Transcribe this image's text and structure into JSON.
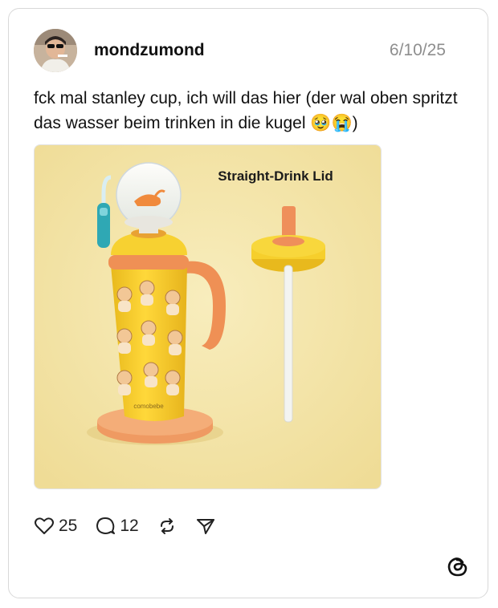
{
  "post": {
    "username": "mondzumond",
    "date": "6/10/25",
    "text": "fck mal stanley cup, ich will das hier (der wal oben spritzt das wasser beim trinken in die kugel 🥹😭)",
    "image": {
      "caption": "Straight-Drink Lid",
      "brand": "comobebe"
    }
  },
  "actions": {
    "likes": "25",
    "replies": "12"
  },
  "icons": {
    "like": "heart-icon",
    "reply": "comment-icon",
    "repost": "repost-icon",
    "share": "send-icon",
    "app": "threads-logo-icon"
  },
  "colors": {
    "background": "#f3e3a6",
    "tumbler": "#f6cf2c",
    "accent": "#f0955b"
  }
}
